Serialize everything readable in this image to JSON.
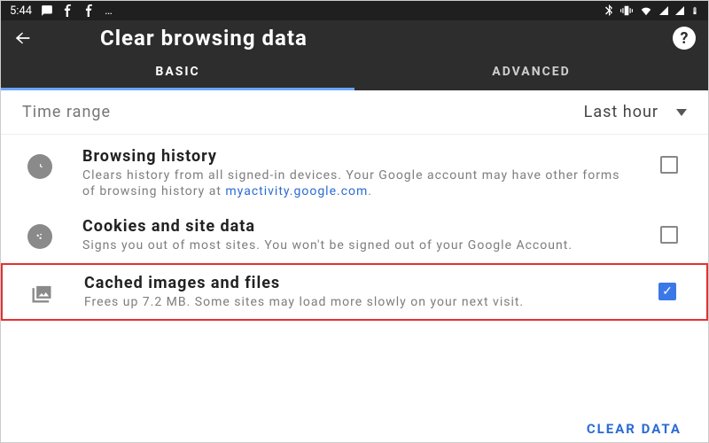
{
  "statusbar": {
    "time": "5:44"
  },
  "header": {
    "title": "Clear browsing data"
  },
  "tabs": {
    "basic": "BASIC",
    "advanced": "ADVANCED"
  },
  "timerange": {
    "label": "Time range",
    "value": "Last hour"
  },
  "items": [
    {
      "title": "Browsing history",
      "desc_pre": "Clears history from all signed-in devices. Your Google account may have other forms of browsing history at ",
      "link": "myactivity.google.com",
      "desc_post": "."
    },
    {
      "title": "Cookies and site data",
      "desc": "Signs you out of most sites. You won't be signed out of your Google Account."
    },
    {
      "title": "Cached images and files",
      "desc": "Frees up 7.2 MB. Some sites may load more slowly on your next visit."
    }
  ],
  "footer": {
    "clear": "CLEAR DATA"
  }
}
